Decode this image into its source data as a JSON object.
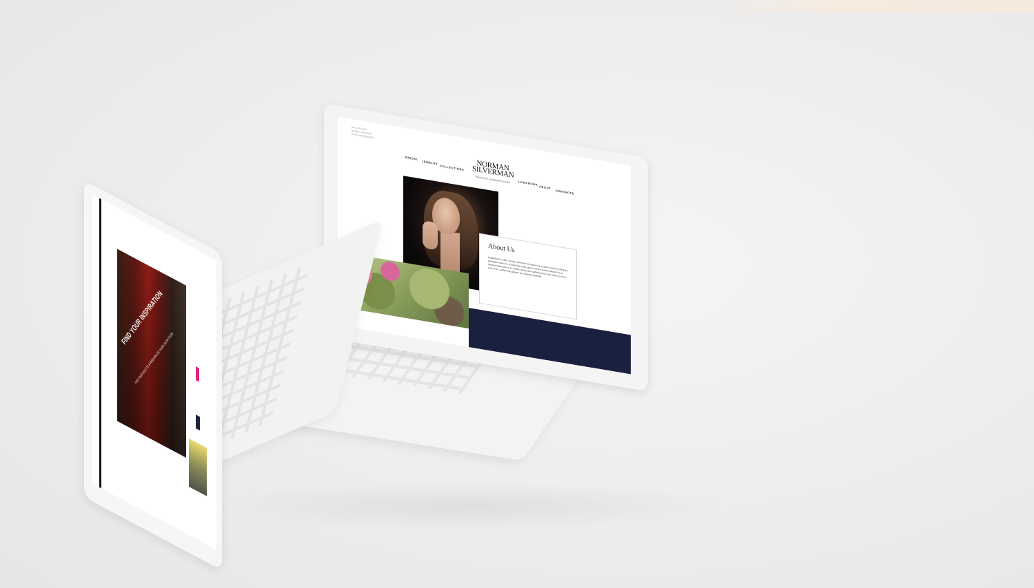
{
  "laptop_back": {
    "account_links": [
      "MY ACCOUNT",
      "STORE LOCATOR",
      "CATALOG REQUEST"
    ],
    "nav_left": [
      "BRIDAL",
      "JEWELRY",
      "COLLECTIONS"
    ],
    "nav_right": [
      "LOOKBOOK",
      "ABOUT",
      "CONTACTS"
    ],
    "logo_line1": "NORMAN",
    "logo_line2": "SILVERMAN",
    "tagline": "Passion for exceptional jewelry",
    "about_title": "About Us",
    "about_body": "Established in 1965, Norman Silverman Company has made its mark by offering a prestigious selection of large diamonds, gems and fine jewelry. Backed by an industry-leading focus on quality, artistry and craftsmanship, each piece is a true work of art, crafted with passion for exceptional jewelry."
  },
  "laptop_front": {
    "headline": "FIND YOUR INSPIRATION",
    "subline": "PICK YOUR PALETTE & PERSONALIZE YOUR COLOR STORY"
  },
  "colors": {
    "navy": "#19213f",
    "pink_accent": "#e0267a",
    "background": "#ededed"
  }
}
